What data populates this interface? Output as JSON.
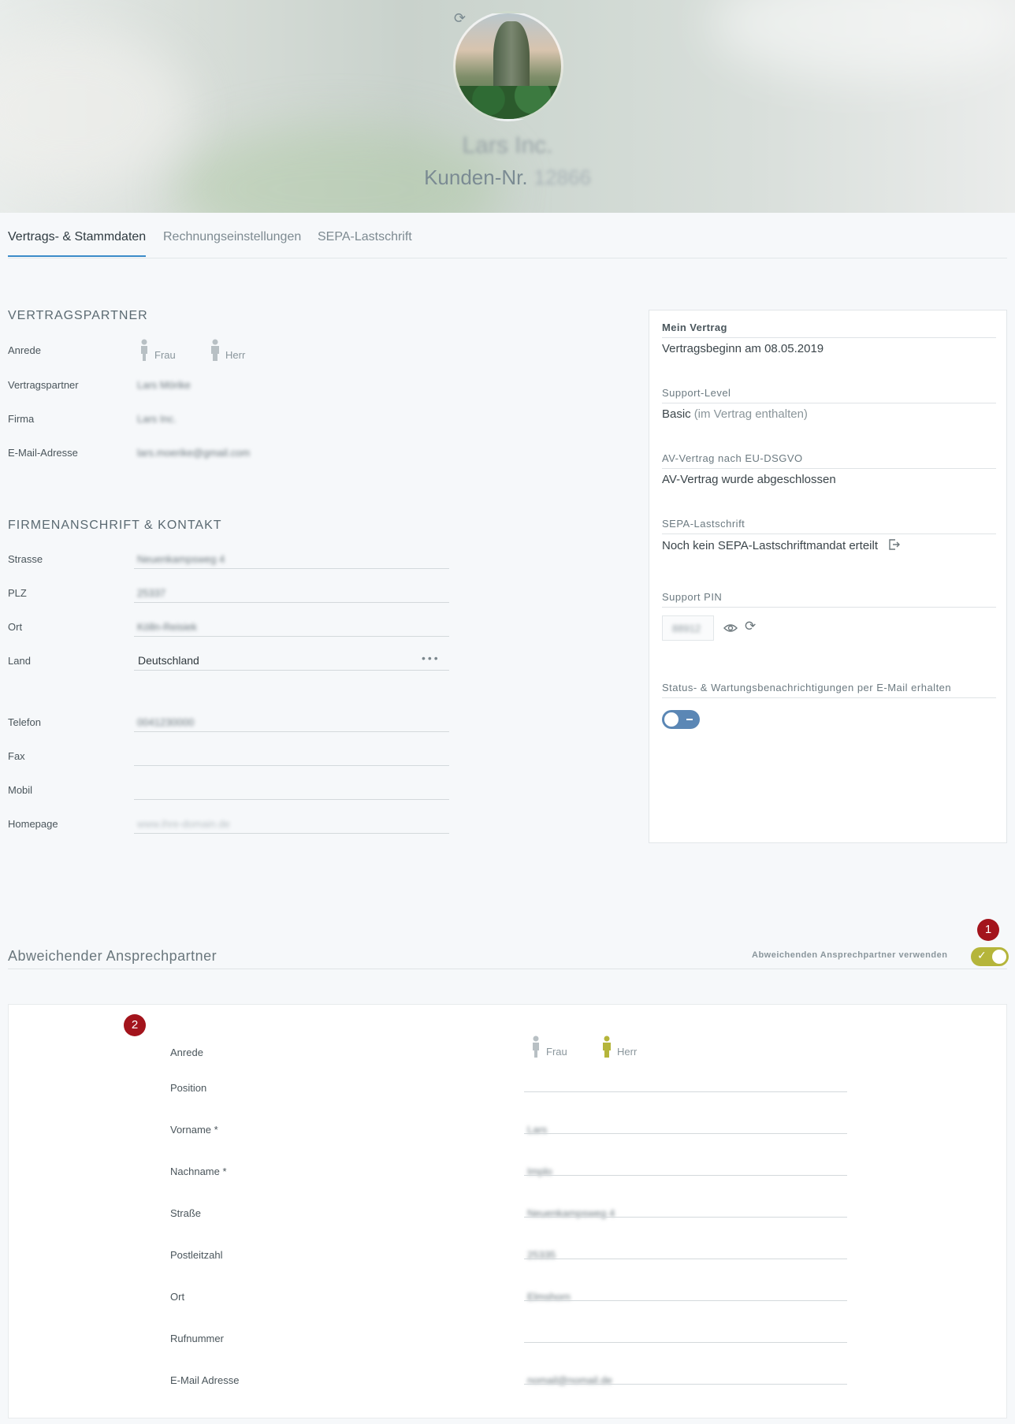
{
  "header": {
    "company_name": "Lars Inc.",
    "customer_label": "Kunden-Nr.",
    "customer_number": "12866"
  },
  "tabs": [
    {
      "label": "Vertrags- & Stammdaten",
      "active": true
    },
    {
      "label": "Rechnungseinstellungen",
      "active": false
    },
    {
      "label": "SEPA-Lastschrift",
      "active": false
    }
  ],
  "vertragspartner": {
    "title": "VERTRAGSPARTNER",
    "anrede_label": "Anrede",
    "frau": "Frau",
    "herr": "Herr",
    "partner_label": "Vertragspartner",
    "partner_value": "Lars Mörike",
    "firma_label": "Firma",
    "firma_value": "Lars Inc.",
    "email_label": "E-Mail-Adresse",
    "email_value": "lars.moerike@gmail.com"
  },
  "anschrift": {
    "title": "FIRMENANSCHRIFT & KONTAKT",
    "strasse_label": "Strasse",
    "strasse_value": "Neuenkampsweg 4",
    "plz_label": "PLZ",
    "plz_value": "25337",
    "ort_label": "Ort",
    "ort_value": "Kölln-Reisiek",
    "land_label": "Land",
    "land_value": "Deutschland",
    "telefon_label": "Telefon",
    "telefon_value": "0041230000",
    "fax_label": "Fax",
    "mobil_label": "Mobil",
    "homepage_label": "Homepage",
    "homepage_placeholder": "www.ihre-domain.de"
  },
  "vertrag": {
    "mein_vertrag_title": "Mein Vertrag",
    "vertragsbeginn": "Vertragsbeginn am 08.05.2019",
    "support_level_title": "Support-Level",
    "support_level_value": "Basic",
    "support_level_note": "(im Vertrag enthalten)",
    "av_title": "AV-Vertrag nach EU-DSGVO",
    "av_value": "AV-Vertrag wurde abgeschlossen",
    "sepa_title": "SEPA-Lastschrift",
    "sepa_value": "Noch kein SEPA-Lastschriftmandat erteilt",
    "pin_title": "Support PIN",
    "pin_value": "88912",
    "status_title": "Status- & Wartungsbenachrichtigungen per E-Mail erhalten"
  },
  "ansprechpartner": {
    "title": "Abweichender Ansprechpartner",
    "toggle_label": "Abweichenden Ansprechpartner verwenden",
    "badge1": "1",
    "badge2": "2",
    "anrede_label": "Anrede",
    "frau": "Frau",
    "herr": "Herr",
    "position_label": "Position",
    "vorname_label": "Vorname *",
    "vorname_value": "Lars",
    "nachname_label": "Nachname *",
    "nachname_value": "Implo",
    "strasse_label": "Straße",
    "strasse_value": "Neuenkampsweg 4",
    "plz_label": "Postleitzahl",
    "plz_value": "25335",
    "ort_label": "Ort",
    "ort_value": "Elmshorn",
    "ruf_label": "Rufnummer",
    "email_label": "E-Mail Adresse",
    "email_value": "nomail@nomail.de"
  },
  "colors": {
    "accent_blue": "#3b8bc9",
    "toggle_on": "#b5b53b",
    "toggle_off": "#5b87b5",
    "badge": "#a3141c"
  }
}
